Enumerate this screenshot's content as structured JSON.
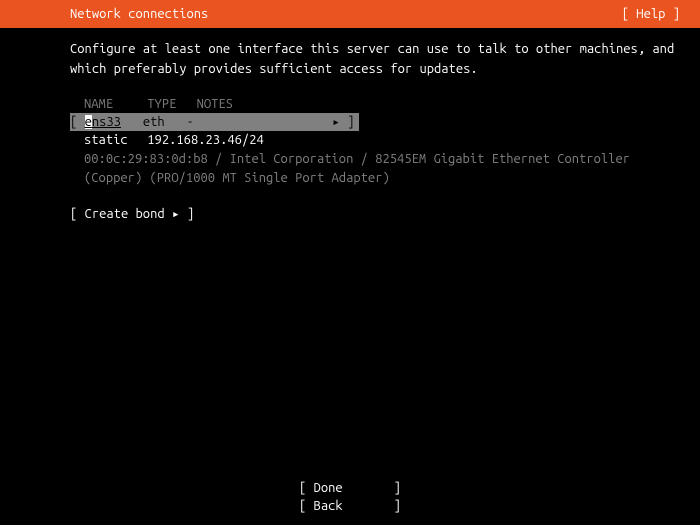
{
  "header": {
    "title": "Network connections",
    "help": "[ Help ]"
  },
  "intro": "Configure at least one interface this server can use to talk to other machines, and which preferably provides sufficient access for updates.",
  "table": {
    "headers": {
      "name": "NAME",
      "type": "TYPE",
      "notes": "NOTES"
    },
    "interface": {
      "bracket_open": "[ ",
      "name": "ens33",
      "type": "eth",
      "notes": "-",
      "arrow": "▸",
      "bracket_close": " ]"
    },
    "address": {
      "mode": "static",
      "value": "192.168.23.46/24"
    },
    "hw": "00:0c:29:83:0d:b8 / Intel Corporation / 82545EM Gigabit Ethernet Controller (Copper) (PRO/1000 MT Single Port Adapter)"
  },
  "create_bond": "[ Create bond ▸ ]",
  "footer": {
    "done": "[ Done       ]",
    "back": "[ Back       ]"
  }
}
